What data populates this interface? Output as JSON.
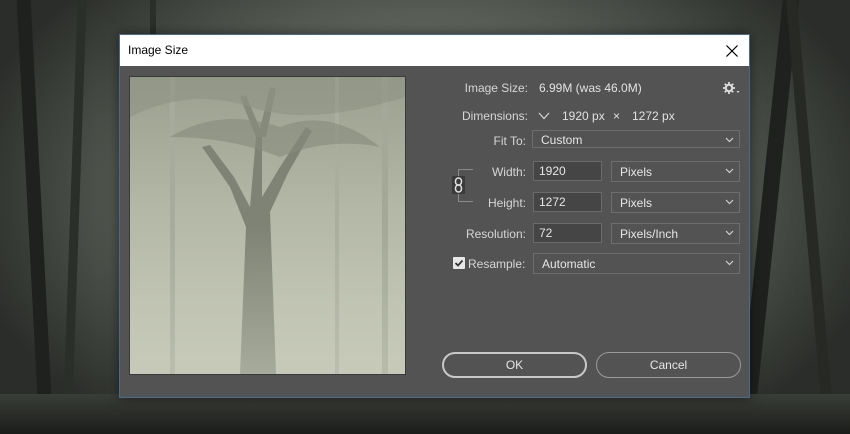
{
  "dialog": {
    "title": "Image Size",
    "close_icon": "close-icon"
  },
  "image_size": {
    "label": "Image Size:",
    "value": "6.99M (was 46.0M)"
  },
  "dimensions": {
    "label": "Dimensions:",
    "width": "1920 px",
    "separator": "×",
    "height": "1272 px"
  },
  "fit_to": {
    "label": "Fit To:",
    "value": "Custom"
  },
  "width": {
    "label": "Width:",
    "value": "1920",
    "unit": "Pixels"
  },
  "height": {
    "label": "Height:",
    "value": "1272",
    "unit": "Pixels"
  },
  "resolution": {
    "label": "Resolution:",
    "value": "72",
    "unit": "Pixels/Inch"
  },
  "resample": {
    "label": "Resample:",
    "checked": true,
    "value": "Automatic"
  },
  "buttons": {
    "ok": "OK",
    "cancel": "Cancel"
  },
  "colors": {
    "dialog_bg": "#535353",
    "titlebar_bg": "#ffffff",
    "field_bg": "#454545"
  }
}
